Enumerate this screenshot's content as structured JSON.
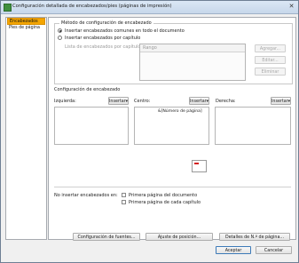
{
  "window": {
    "title": "Configuración detallada de encabezados/pies (páginas de impresión)",
    "close_glyph": "✕"
  },
  "sidebar": {
    "items": [
      {
        "label": "Encabezados",
        "selected": true
      },
      {
        "label": "Pies de página",
        "selected": false
      }
    ]
  },
  "method": {
    "legend": "Método de configuración de encabezado",
    "option_all": "Insertar encabezados comunes en todo el documento",
    "option_chapter": "Insertar encabezados por capítulo",
    "list_label": "Lista de encabezados por capítulo:",
    "list_header": "Rango",
    "buttons": {
      "add": "Agregar...",
      "edit": "Editar...",
      "delete": "Eliminar"
    }
  },
  "header_config": {
    "title": "Configuración de encabezado",
    "left_label": "Izquierda:",
    "center_label": "Centro:",
    "right_label": "Derecha:",
    "insert_label": "Insertar",
    "insert_arrow": "▾",
    "center_value": "&[Número de página]",
    "left_value": "",
    "right_value": ""
  },
  "no_insert": {
    "label": "No insertar encabezados en:",
    "first_page_doc": "Primera página del documento",
    "first_page_chapter": "Primera página de cada capítulo"
  },
  "bottom_buttons": {
    "font": "Configuración de fuentes...",
    "position": "Ajuste de posición...",
    "page_number": "Detalles de N.º de página..."
  },
  "footer": {
    "ok": "Aceptar",
    "cancel": "Cancelar"
  },
  "colors": {
    "selection": "#f4a500",
    "preview_marker": "#d42020"
  }
}
